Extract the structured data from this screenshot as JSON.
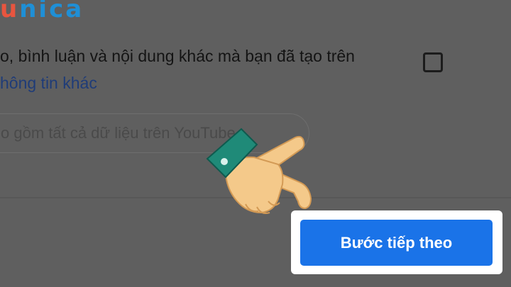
{
  "logo": {
    "part1": "u",
    "part2": "nica"
  },
  "consent_row": {
    "text": "o, bình luận và nội dung khác mà bạn đã tạo trên",
    "link": "hông tin khác"
  },
  "search": {
    "text": "o gồm tất cả dữ liệu trên YouTube"
  },
  "next_button": {
    "label": "Bước tiếp theo"
  },
  "colors": {
    "overlay": "#5f5f5f",
    "button_bg": "#1a73e8",
    "logo_red": "#e8553f",
    "logo_blue": "#1f8fd6",
    "cuff": "#1f8a78",
    "skin": "#f4c98a"
  },
  "icons": {
    "pointer": "pointing-hand-icon"
  }
}
